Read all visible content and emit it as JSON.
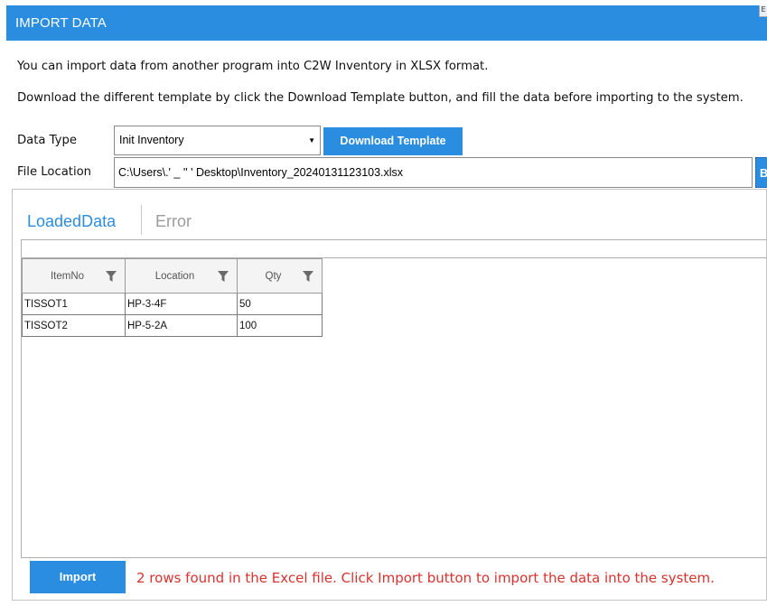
{
  "window": {
    "title": "IMPORT DATA",
    "corner_button": "E"
  },
  "intro": {
    "line1": "You can import data from another program into C2W Inventory in XLSX format.",
    "line2": "Download the different template by click the Download Template button, and fill the data before importing to the system."
  },
  "form": {
    "data_type_label": "Data Type",
    "data_type_value": "Init Inventory",
    "download_button": "Download Template",
    "file_location_label": "File Location",
    "file_location_value": "C:\\Users\\.'   _ '' '  Desktop\\Inventory_20240131123103.xlsx",
    "browse_button": "Br"
  },
  "tabs": {
    "loaded": "LoadedData",
    "error": "Error"
  },
  "grid": {
    "columns": [
      "ItemNo",
      "Location",
      "Qty"
    ],
    "rows": [
      [
        "TISSOT1",
        "HP-3-4F",
        "50"
      ],
      [
        "TISSOT2",
        "HP-5-2A",
        "100"
      ]
    ]
  },
  "footer": {
    "import_button": "Import",
    "status": "2 rows found in the Excel file. Click Import button to import the data into the system."
  },
  "colors": {
    "accent": "#2b8de0",
    "status_error": "#d9322e",
    "tab_inactive": "#9c9c9c"
  },
  "icons": {
    "dropdown": "chevron-down-icon",
    "filter": "filter-icon"
  }
}
